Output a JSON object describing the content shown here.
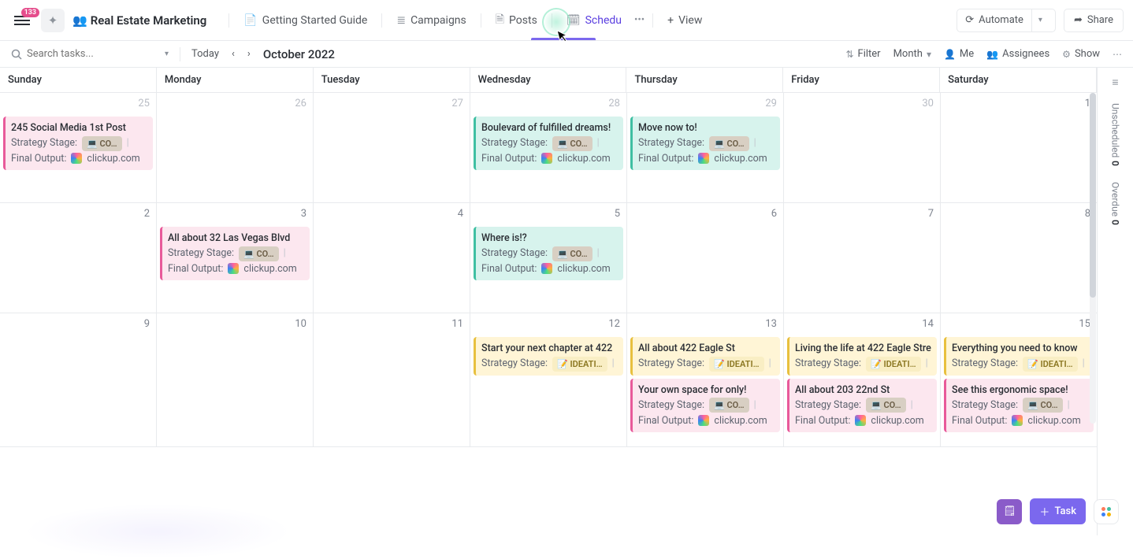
{
  "header": {
    "badge": "133",
    "title_emoji": "👥",
    "title": "Real Estate Marketing",
    "tabs": [
      {
        "icon": "📄",
        "label": "Getting Started Guide"
      },
      {
        "icon": "≣",
        "label": "Campaigns"
      },
      {
        "icon": "🗎",
        "label": "Posts"
      },
      {
        "icon": "🗓",
        "label": "Schedu"
      }
    ],
    "ellipsis": "•••",
    "add_view_icon": "+",
    "add_view": "View",
    "automate_icon": "⟳",
    "automate": "Automate",
    "share_icon": "➦",
    "share": "Share"
  },
  "toolbar": {
    "search_placeholder": "Search tasks...",
    "today": "Today",
    "month_label": "October 2022",
    "filter": "Filter",
    "month_btn": "Month",
    "me": "Me",
    "assignees": "Assignees",
    "show": "Show"
  },
  "day_names": [
    "Sunday",
    "Monday",
    "Tuesday",
    "Wednesday",
    "Thursday",
    "Friday",
    "Saturday"
  ],
  "labels": {
    "strategy": "Strategy Stage:",
    "output": "Final Output:",
    "clickup": "clickup.com",
    "stage_copy": "CO…",
    "stage_ideation": "IDEATI…"
  },
  "rail": {
    "unscheduled_count": "0",
    "unscheduled": "Unscheduled",
    "overdue_count": "0",
    "overdue": "Overdue"
  },
  "fab": {
    "task": "Task"
  },
  "weeks": [
    {
      "days": [
        {
          "num": "25",
          "prev": true,
          "tasks": [
            {
              "color": "pink",
              "title": "245 Social Media 1st Post",
              "stage": "copy",
              "output": true
            }
          ]
        },
        {
          "num": "26",
          "prev": true
        },
        {
          "num": "27",
          "prev": true
        },
        {
          "num": "28",
          "prev": true,
          "tasks": [
            {
              "color": "teal",
              "title": "Boulevard of fulfilled dreams!",
              "stage": "copy",
              "output": true
            }
          ]
        },
        {
          "num": "29",
          "prev": true,
          "tasks": [
            {
              "color": "teal",
              "title": "Move now to!",
              "stage": "copy",
              "output": true
            }
          ]
        },
        {
          "num": "30",
          "prev": true
        },
        {
          "num": "1"
        }
      ]
    },
    {
      "days": [
        {
          "num": "2"
        },
        {
          "num": "3",
          "tasks": [
            {
              "color": "pink",
              "title": "All about 32 Las Vegas Blvd",
              "stage": "copy",
              "output": true
            }
          ]
        },
        {
          "num": "4"
        },
        {
          "num": "5",
          "tasks": [
            {
              "color": "teal",
              "title": "Where is!?",
              "stage": "copy",
              "output": true
            }
          ]
        },
        {
          "num": "6"
        },
        {
          "num": "7"
        },
        {
          "num": "8"
        }
      ]
    },
    {
      "days": [
        {
          "num": "9"
        },
        {
          "num": "10"
        },
        {
          "num": "11"
        },
        {
          "num": "12",
          "tasks": [
            {
              "color": "yellow",
              "title": "Start your next chapter at 422",
              "stage": "ideation"
            }
          ]
        },
        {
          "num": "13",
          "tasks": [
            {
              "color": "yellow",
              "title": "All about 422 Eagle St",
              "stage": "ideation"
            },
            {
              "color": "pink",
              "title": "Your own space for only!",
              "stage": "copy",
              "output": true
            }
          ]
        },
        {
          "num": "14",
          "tasks": [
            {
              "color": "yellow",
              "title": "Living the life at 422 Eagle Stre",
              "stage": "ideation"
            },
            {
              "color": "pink",
              "title": "All about 203 22nd St",
              "stage": "copy",
              "output": true
            }
          ]
        },
        {
          "num": "15",
          "tasks": [
            {
              "color": "yellow",
              "title": "Everything you need to know",
              "stage": "ideation"
            },
            {
              "color": "pink",
              "title": "See this ergonomic space!",
              "stage": "copy",
              "output": true
            }
          ]
        }
      ]
    }
  ]
}
